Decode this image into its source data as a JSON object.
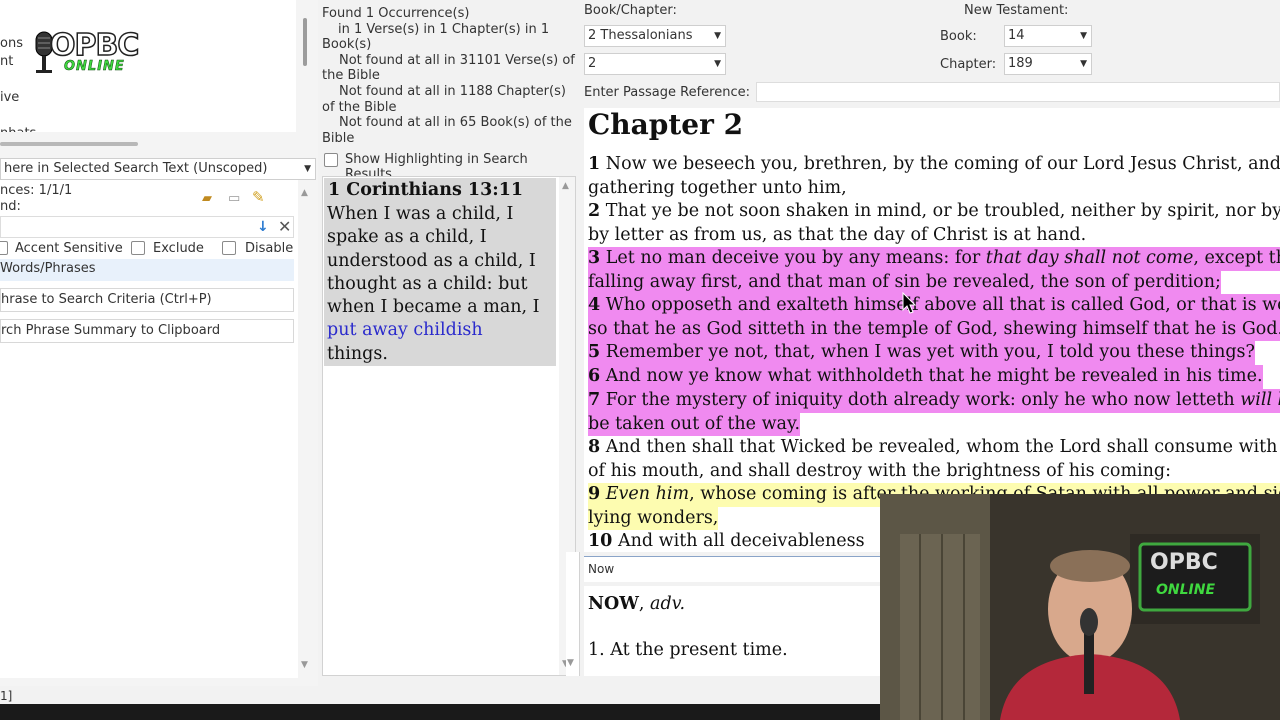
{
  "left": {
    "tree_items": [
      "ons",
      "nt",
      "ive",
      "nhats"
    ],
    "logo": {
      "top": "OPBC",
      "bottom": "ONLINE"
    },
    "scope_select": "here in Selected Search Text (Unscoped)",
    "occurrences_label": "nces: 1/1/1",
    "found_label": "nd:",
    "checkboxes": {
      "accent": "Accent Sensitive",
      "exclude": "Exclude",
      "disable": "Disable"
    },
    "words_phrases": "Words/Phrases",
    "add_phrase": "hrase to Search Criteria (Ctrl+P)",
    "copy_summary": "rch Phrase Summary to Clipboard",
    "status_fragment": "1]"
  },
  "results": {
    "summary": [
      "Found 1 Occurrence(s)",
      "in 1 Verse(s) in 1 Chapter(s) in 1",
      "Book(s)",
      "Not found at all in 31101 Verse(s) of",
      "the Bible",
      "Not found at all in 1188 Chapter(s)",
      "of the Bible",
      "Not found at all in 65 Book(s) of the",
      "Bible"
    ],
    "show_highlighting": "Show Highlighting in Search Results",
    "item_ref": "1 Corinthians 13:11",
    "item_lines": [
      "When I was a child, I",
      "spake as a child, I",
      "understood as a child, I",
      "thought as a child: but",
      "when I became a man, I"
    ],
    "item_match": "put away childish",
    "item_last": "things."
  },
  "main": {
    "book_chapter_label": "Book/Chapter:",
    "book_value": "2 Thessalonians",
    "chapter_value": "2",
    "passage_label": "Enter Passage Reference:",
    "nt_label": "New Testament:",
    "book_label": "Book:",
    "book_num": "14",
    "chapter_label": "Chapter:",
    "chapter_num": "189",
    "chapter_heading": "Chapter 2"
  },
  "verses": [
    {
      "n": "1",
      "lines": [
        "Now we beseech you, brethren, by the coming of our Lord Jesus Christ, and by our",
        "gathering together unto him,"
      ]
    },
    {
      "n": "2",
      "lines": [
        "That ye be not soon shaken in mind, or be troubled, neither by spirit, nor by word, nor",
        "by letter as from us, as that the day of Christ is at hand."
      ]
    },
    {
      "n": "3",
      "lines": [
        "Let no man deceive you by any means: for ",
        "falling away first, and that man of sin be revealed, the son of perdition;"
      ],
      "italic": "that day shall not come",
      "tail": ", except there come a"
    },
    {
      "n": "4",
      "lines": [
        "Who opposeth and exalteth himself above all that is called God, or that is worshipped;",
        "so that he as God sitteth in the temple of God, shewing himself that he is God."
      ]
    },
    {
      "n": "5",
      "lines": [
        "Remember ye not, that, when I was yet with you, I told you these things?"
      ]
    },
    {
      "n": "6",
      "lines": [
        "And now ye know what withholdeth that he might be revealed in his time."
      ]
    },
    {
      "n": "7",
      "lines": [
        "For the mystery of iniquity doth already work: only he who now letteth ",
        "be taken out of the way."
      ],
      "italic": "will let"
    },
    {
      "n": "8",
      "lines": [
        "And then shall that Wicked be revealed, whom the Lord shall consume with the spirit",
        "of his mouth, and shall destroy with the brightness of his coming:"
      ]
    },
    {
      "n": "9",
      "lines": [
        ", whose coming is after the working of Satan with all power and signs and",
        "lying wonders,"
      ],
      "italic": "Even him"
    },
    {
      "n": "10",
      "lines": [
        "And with all deceivableness"
      ]
    }
  ],
  "dictionary": {
    "word": "Now",
    "headword": "NOW",
    "pos": "adv.",
    "definition": "1. At the present time."
  },
  "webcam": {
    "logo_top": "OPBC",
    "logo_bottom": "ONLINE"
  },
  "colors": {
    "highlight_pink": "#f08af0",
    "highlight_yellow": "#fdfcb0",
    "match_blue": "#2a2acc"
  }
}
